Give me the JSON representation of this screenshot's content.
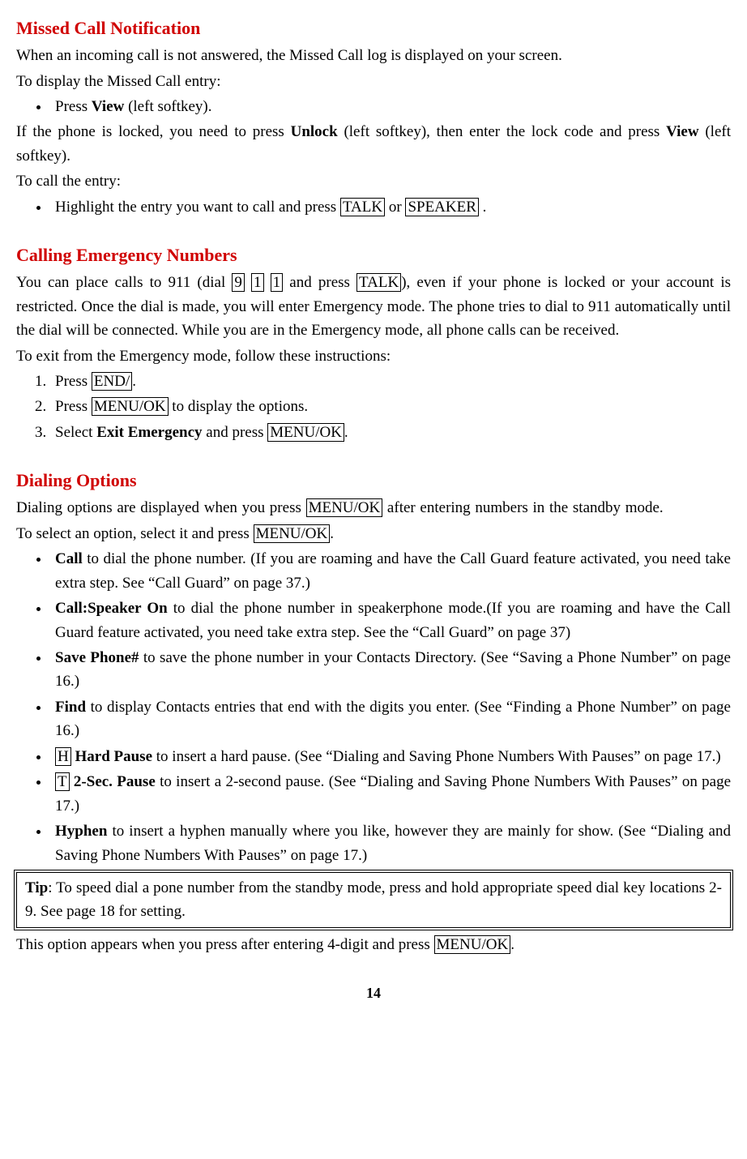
{
  "page_number": "14",
  "s1": {
    "heading": "Missed Call Notification",
    "p1": "When an incoming call is not answered, the Missed Call log is displayed on your screen.",
    "p2": "To display the Missed Call entry:",
    "bullet1_pre": "Press ",
    "bullet1_bold": "View",
    "bullet1_post": " (left softkey).",
    "p3_pre": "If the phone is locked, you need to press ",
    "p3_bold1": "Unlock",
    "p3_mid": " (left softkey), then enter the lock code and press ",
    "p3_bold2": "View",
    "p3_post": " (left softkey).",
    "p4": "To call the entry:",
    "bullet2_pre": "Highlight the entry you want to call and press ",
    "bullet2_key1": "TALK",
    "bullet2_mid": " or ",
    "bullet2_key2": "SPEAKER",
    "bullet2_post": " ."
  },
  "s2": {
    "heading": "Calling Emergency Numbers",
    "p1_pre": "You can place calls to 911 (dial ",
    "p1_k1": "9",
    "p1_k2": "1",
    "p1_k3": "1",
    "p1_mid1": " and press ",
    "p1_k4": "TALK",
    "p1_post": "), even if your phone is locked or your account is restricted. Once the dial is made, you will enter Emergency mode. The phone tries to dial to 911 automatically until the dial will be connected. While you are in the Emergency mode, all phone calls can be received.",
    "p2": "To exit from the Emergency mode, follow these instructions:",
    "ol1_pre": "Press ",
    "ol1_key": "END/",
    "ol1_post": ".",
    "ol2_pre": "Press ",
    "ol2_key": "MENU/OK",
    "ol2_post": " to display the options.",
    "ol3_pre": "Select ",
    "ol3_bold": "Exit Emergency",
    "ol3_mid": " and press ",
    "ol3_key": "MENU/OK",
    "ol3_post": "."
  },
  "s3": {
    "heading": "Dialing Options",
    "p1_pre": "Dialing options are displayed when you press ",
    "p1_key": "MENU/OK",
    "p1_post": " after entering numbers in the standby mode.",
    "p2_pre": "To select an option, select it and press ",
    "p2_key": "MENU/OK",
    "p2_post": ".",
    "b1_bold": "Call",
    "b1_post": " to dial the phone number. (If you are roaming and have the Call Guard feature activated, you need take extra step. See “Call Guard” on page 37.)",
    "b2_bold": "Call:Speaker On",
    "b2_post": " to dial the phone number in speakerphone mode.(If you are roaming and have the Call Guard feature activated, you need take extra step. See the “Call Guard” on page 37)",
    "b3_bold": "Save Phone#",
    "b3_post": " to save the phone number in your Contacts Directory. (See “Saving a Phone Number” on page 16.)",
    "b4_bold": "Find",
    "b4_post": " to display Contacts entries that end with the digits you enter. (See “Finding a Phone Number” on page 16.)",
    "b5_key": "H",
    "b5_bold": " Hard Pause",
    "b5_post": " to insert a hard pause. (See “Dialing and Saving Phone Numbers With Pauses” on page 17.)",
    "b6_key": "T",
    "b6_bold": " 2-Sec. Pause",
    "b6_post": " to insert a 2-second pause. (See “Dialing and Saving Phone Numbers With Pauses” on page 17.)",
    "b7_bold": "Hyphen",
    "b7_post": " to insert a hyphen manually where you like, however they are mainly for show. (See “Dialing and Saving Phone Numbers With Pauses” on page 17.)",
    "tip_bold": "Tip",
    "tip_post": ": To speed dial a pone number from the standby mode, press and hold appropriate speed dial key locations 2-9. See page 18 for setting.",
    "p_last_pre": "This option appears when you press after entering 4-digit and press ",
    "p_last_key": "MENU/OK",
    "p_last_post": "."
  }
}
